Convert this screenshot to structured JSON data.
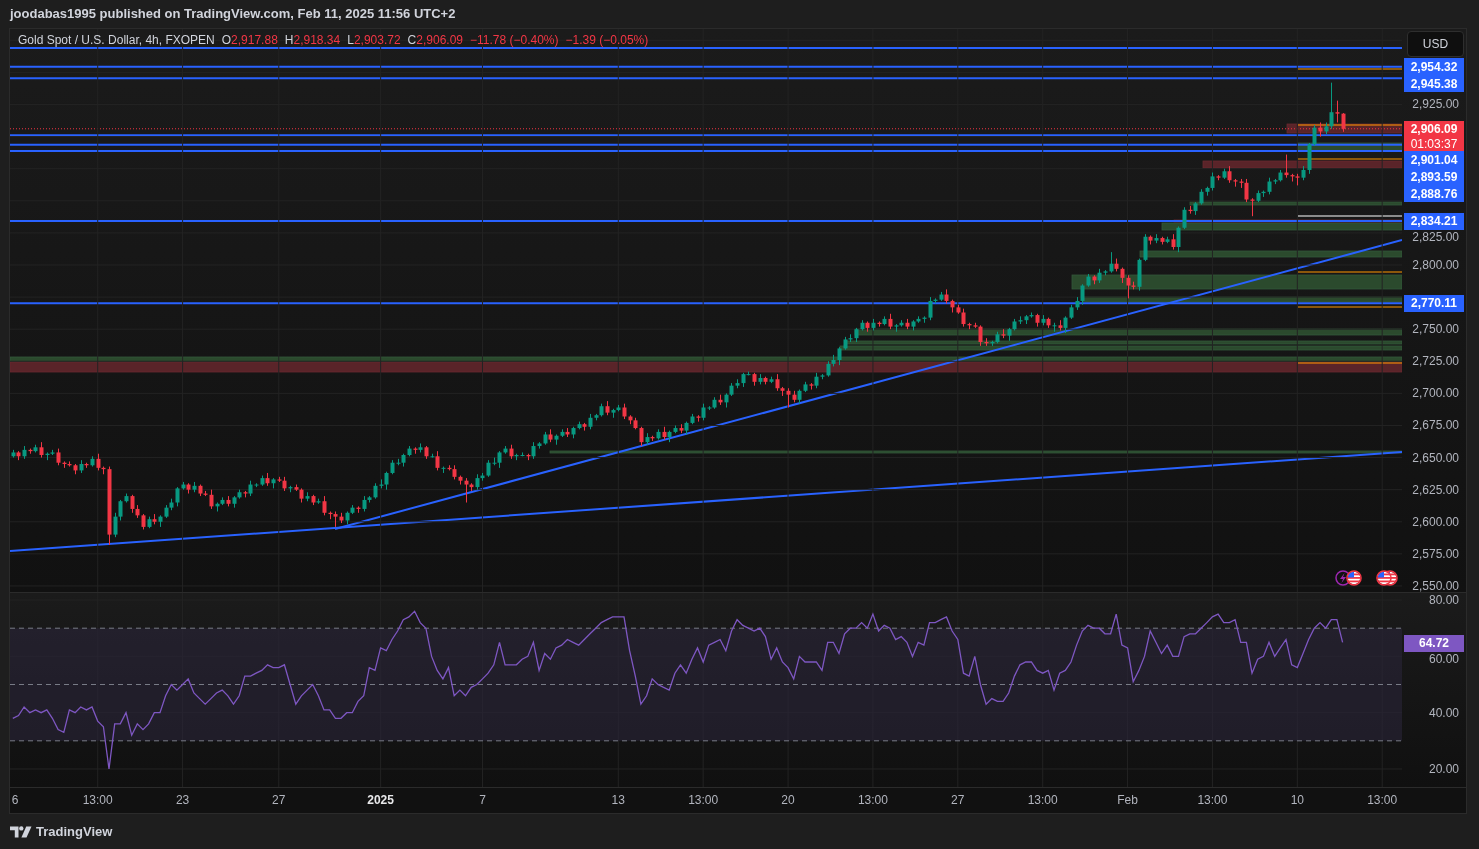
{
  "header": {
    "publish_note": "joodabas1995 published on TradingView.com, Feb 11, 2025 11:56 UTC+2"
  },
  "price_chart": {
    "legend": {
      "symbol": "Gold Spot / U.S. Dollar, 4h, FXOPEN",
      "ohlc": [
        {
          "key": "O",
          "value": "2,917.88"
        },
        {
          "key": "H",
          "value": "2,918.34"
        },
        {
          "key": "L",
          "value": "2,903.72"
        },
        {
          "key": "C",
          "value": "2,906.09"
        }
      ],
      "changes": [
        "−11.78 (−0.40%)",
        "−1.39 (−0.05%)"
      ]
    },
    "currency_button": "USD",
    "price_lines": [
      "2,954.32",
      "2,945.38",
      "2,901.04",
      "2,893.59",
      "2,888.76",
      "2,834.21",
      "2,770.11"
    ],
    "last_price": {
      "label": "2,906.09",
      "countdown": "01:03:37"
    },
    "chart_data": {
      "type": "candlestick",
      "grid": true,
      "ylim": [
        2545.3,
        2983.8
      ],
      "yticks": [
        {
          "value": 2925,
          "label": "2,925.00"
        },
        {
          "value": 2825,
          "label": "2,825.00"
        },
        {
          "value": 2800,
          "label": "2,800.00"
        },
        {
          "value": 2750,
          "label": "2,750.00"
        },
        {
          "value": 2725,
          "label": "2,725.00"
        },
        {
          "value": 2700,
          "label": "2,700.00"
        },
        {
          "value": 2675,
          "label": "2,675.00"
        },
        {
          "value": 2650,
          "label": "2,650.00"
        },
        {
          "value": 2625,
          "label": "2,625.00"
        },
        {
          "value": 2600,
          "label": "2,600.00"
        },
        {
          "value": 2575,
          "label": "2,575.00"
        },
        {
          "value": 2550,
          "label": "2,550.00"
        }
      ],
      "categories": [
        null,
        null,
        null,
        null,
        null,
        null,
        null,
        null,
        null,
        null,
        null,
        null,
        null,
        null,
        null,
        null,
        null,
        null,
        null,
        null,
        null,
        null,
        null,
        null,
        null,
        null,
        null,
        null,
        null,
        null,
        null,
        null,
        null,
        null,
        null,
        null,
        null,
        null,
        null,
        null,
        null,
        null,
        null,
        null,
        null,
        null,
        null,
        null,
        null,
        null,
        null,
        null,
        null,
        null,
        null,
        null,
        null,
        null,
        null,
        null,
        null,
        null,
        null,
        null,
        null,
        null,
        null,
        null,
        null,
        null,
        null,
        null,
        null,
        null,
        null,
        null,
        null,
        null,
        null,
        null,
        null,
        null,
        null,
        null,
        null,
        null,
        null,
        null,
        null,
        null,
        null,
        null,
        null,
        null,
        null,
        null,
        null,
        null,
        null,
        null,
        null,
        null,
        null,
        null,
        null,
        null,
        null,
        null,
        null,
        null,
        null,
        null,
        null,
        null,
        null,
        null,
        null,
        null,
        null,
        null,
        null,
        null,
        null,
        null,
        null,
        null,
        null,
        null,
        null,
        null,
        null,
        null,
        null,
        null,
        null,
        null,
        null,
        null,
        null,
        null,
        null,
        null,
        null,
        null,
        null,
        null,
        null,
        null,
        null,
        null,
        null,
        null,
        null,
        null,
        null,
        null,
        null,
        null,
        null,
        null,
        null,
        null,
        null,
        null,
        null,
        null,
        null,
        null,
        null,
        null,
        null,
        null,
        null,
        null,
        null,
        null,
        null,
        null,
        null,
        null,
        null,
        null,
        null,
        null,
        null,
        null,
        null,
        null,
        null,
        null,
        null,
        null,
        null,
        null,
        null,
        null,
        null,
        null,
        null,
        null,
        null,
        null,
        null,
        null,
        null,
        null,
        null,
        null,
        null,
        null,
        null,
        null,
        null,
        null,
        null,
        null,
        null,
        null,
        null,
        null,
        null,
        null,
        null,
        null,
        null,
        null,
        null,
        null,
        null,
        null,
        null,
        null,
        null,
        null,
        null,
        null,
        null,
        null,
        null,
        null,
        null,
        null,
        null,
        null,
        null,
        null
      ],
      "ohlc": [
        [
          2651,
          2656,
          2650,
          2654
        ],
        [
          2654,
          2655,
          2648,
          2651
        ],
        [
          2651,
          2659,
          2649,
          2656
        ],
        [
          2656,
          2657,
          2653,
          2655
        ],
        [
          2655,
          2660,
          2654,
          2658
        ],
        [
          2658,
          2662,
          2650,
          2652
        ],
        [
          2652,
          2654,
          2648,
          2653
        ],
        [
          2653,
          2656,
          2652,
          2654
        ],
        [
          2654,
          2657,
          2644,
          2646
        ],
        [
          2646,
          2647,
          2642,
          2645
        ],
        [
          2645,
          2647,
          2643,
          2644
        ],
        [
          2644,
          2645,
          2637,
          2640
        ],
        [
          2640,
          2648,
          2638,
          2645
        ],
        [
          2645,
          2646,
          2642,
          2644
        ],
        [
          2644,
          2651,
          2643,
          2649
        ],
        [
          2649,
          2653,
          2640,
          2642
        ],
        [
          2642,
          2643,
          2637,
          2641
        ],
        [
          2641,
          2643,
          2582,
          2590
        ],
        [
          2590,
          2607,
          2588,
          2604
        ],
        [
          2604,
          2617,
          2601,
          2616
        ],
        [
          2616,
          2622,
          2615,
          2620
        ],
        [
          2620,
          2621,
          2607,
          2610
        ],
        [
          2610,
          2613,
          2603,
          2605
        ],
        [
          2605,
          2606,
          2594,
          2596
        ],
        [
          2596,
          2604,
          2595,
          2602
        ],
        [
          2602,
          2606,
          2598,
          2600
        ],
        [
          2600,
          2605,
          2596,
          2604
        ],
        [
          2604,
          2613,
          2603,
          2611
        ],
        [
          2611,
          2618,
          2609,
          2615
        ],
        [
          2615,
          2627,
          2612,
          2626
        ],
        [
          2626,
          2631,
          2625,
          2629
        ],
        [
          2629,
          2630,
          2622,
          2625
        ],
        [
          2625,
          2631,
          2623,
          2628
        ],
        [
          2628,
          2629,
          2620,
          2622
        ],
        [
          2622,
          2624,
          2620,
          2621
        ],
        [
          2621,
          2625,
          2610,
          2612
        ],
        [
          2612,
          2615,
          2608,
          2614
        ],
        [
          2614,
          2619,
          2613,
          2617
        ],
        [
          2617,
          2620,
          2612,
          2614
        ],
        [
          2614,
          2620,
          2611,
          2619
        ],
        [
          2619,
          2625,
          2618,
          2623
        ],
        [
          2623,
          2624,
          2619,
          2622
        ],
        [
          2622,
          2632,
          2620,
          2629
        ],
        [
          2629,
          2630,
          2627,
          2629
        ],
        [
          2629,
          2636,
          2628,
          2634
        ],
        [
          2634,
          2638,
          2628,
          2630
        ],
        [
          2630,
          2634,
          2626,
          2633
        ],
        [
          2633,
          2635,
          2631,
          2632
        ],
        [
          2632,
          2635,
          2624,
          2626
        ],
        [
          2626,
          2628,
          2623,
          2627
        ],
        [
          2627,
          2629,
          2624,
          2625
        ],
        [
          2625,
          2626,
          2615,
          2618
        ],
        [
          2618,
          2623,
          2616,
          2620
        ],
        [
          2620,
          2621,
          2613,
          2615
        ],
        [
          2615,
          2618,
          2614,
          2616
        ],
        [
          2616,
          2620,
          2605,
          2607
        ],
        [
          2607,
          2608,
          2602,
          2606
        ],
        [
          2606,
          2608,
          2596,
          2604
        ],
        [
          2604,
          2607,
          2599,
          2601
        ],
        [
          2601,
          2608,
          2598,
          2607
        ],
        [
          2607,
          2613,
          2606,
          2611
        ],
        [
          2611,
          2612,
          2607,
          2610
        ],
        [
          2610,
          2620,
          2608,
          2617
        ],
        [
          2617,
          2620,
          2615,
          2619
        ],
        [
          2619,
          2630,
          2618,
          2628
        ],
        [
          2628,
          2633,
          2626,
          2629
        ],
        [
          2629,
          2639,
          2625,
          2638
        ],
        [
          2638,
          2648,
          2637,
          2646
        ],
        [
          2646,
          2649,
          2644,
          2646
        ],
        [
          2646,
          2653,
          2643,
          2652
        ],
        [
          2652,
          2659,
          2651,
          2657
        ],
        [
          2657,
          2658,
          2653,
          2656
        ],
        [
          2656,
          2661,
          2654,
          2658
        ],
        [
          2658,
          2659,
          2649,
          2651
        ],
        [
          2651,
          2653,
          2650,
          2651
        ],
        [
          2651,
          2655,
          2640,
          2642
        ],
        [
          2642,
          2643,
          2638,
          2642
        ],
        [
          2642,
          2644,
          2640,
          2641
        ],
        [
          2641,
          2644,
          2633,
          2635
        ],
        [
          2635,
          2636,
          2629,
          2632
        ],
        [
          2632,
          2634,
          2615,
          2629
        ],
        [
          2629,
          2630,
          2624,
          2627
        ],
        [
          2627,
          2637,
          2625,
          2634
        ],
        [
          2634,
          2638,
          2632,
          2636
        ],
        [
          2636,
          2648,
          2635,
          2646
        ],
        [
          2646,
          2650,
          2644,
          2646
        ],
        [
          2646,
          2655,
          2642,
          2654
        ],
        [
          2654,
          2659,
          2653,
          2657
        ],
        [
          2657,
          2660,
          2649,
          2651
        ],
        [
          2651,
          2653,
          2648,
          2652
        ],
        [
          2652,
          2654,
          2651,
          2652
        ],
        [
          2652,
          2653,
          2648,
          2651
        ],
        [
          2651,
          2662,
          2649,
          2659
        ],
        [
          2659,
          2662,
          2657,
          2661
        ],
        [
          2661,
          2670,
          2660,
          2668
        ],
        [
          2668,
          2672,
          2662,
          2664
        ],
        [
          2664,
          2668,
          2660,
          2667
        ],
        [
          2667,
          2672,
          2666,
          2670
        ],
        [
          2670,
          2673,
          2666,
          2668
        ],
        [
          2668,
          2674,
          2665,
          2673
        ],
        [
          2673,
          2678,
          2672,
          2676
        ],
        [
          2676,
          2677,
          2671,
          2674
        ],
        [
          2674,
          2684,
          2672,
          2681
        ],
        [
          2681,
          2684,
          2679,
          2683
        ],
        [
          2683,
          2692,
          2682,
          2690
        ],
        [
          2690,
          2694,
          2683,
          2685
        ],
        [
          2685,
          2688,
          2681,
          2687
        ],
        [
          2687,
          2691,
          2686,
          2689
        ],
        [
          2689,
          2692,
          2680,
          2682
        ],
        [
          2682,
          2683,
          2676,
          2679
        ],
        [
          2679,
          2681,
          2672,
          2673
        ],
        [
          2673,
          2674,
          2659,
          2662
        ],
        [
          2662,
          2669,
          2660,
          2666
        ],
        [
          2666,
          2667,
          2663,
          2665
        ],
        [
          2665,
          2672,
          2664,
          2670
        ],
        [
          2670,
          2674,
          2664,
          2666
        ],
        [
          2666,
          2671,
          2662,
          2670
        ],
        [
          2670,
          2675,
          2669,
          2673
        ],
        [
          2673,
          2676,
          2669,
          2671
        ],
        [
          2671,
          2678,
          2668,
          2677
        ],
        [
          2677,
          2684,
          2676,
          2682
        ],
        [
          2682,
          2683,
          2678,
          2681
        ],
        [
          2681,
          2692,
          2679,
          2689
        ],
        [
          2689,
          2690,
          2687,
          2689
        ],
        [
          2689,
          2697,
          2688,
          2695
        ],
        [
          2695,
          2699,
          2691,
          2693
        ],
        [
          2693,
          2700,
          2689,
          2699
        ],
        [
          2699,
          2708,
          2698,
          2706
        ],
        [
          2706,
          2711,
          2704,
          2708
        ],
        [
          2708,
          2716,
          2705,
          2715
        ],
        [
          2715,
          2717,
          2714,
          2715
        ],
        [
          2715,
          2716,
          2706,
          2709
        ],
        [
          2709,
          2715,
          2707,
          2712
        ],
        [
          2712,
          2713,
          2707,
          2709
        ],
        [
          2709,
          2713,
          2708,
          2711
        ],
        [
          2711,
          2715,
          2702,
          2704
        ],
        [
          2704,
          2705,
          2698,
          2702
        ],
        [
          2702,
          2704,
          2689,
          2699
        ],
        [
          2699,
          2702,
          2693,
          2695
        ],
        [
          2695,
          2703,
          2692,
          2702
        ],
        [
          2702,
          2709,
          2701,
          2707
        ],
        [
          2707,
          2708,
          2703,
          2706
        ],
        [
          2706,
          2716,
          2704,
          2713
        ],
        [
          2713,
          2715,
          2711,
          2714
        ],
        [
          2714,
          2725,
          2713,
          2723
        ],
        [
          2723,
          2730,
          2721,
          2726
        ],
        [
          2726,
          2736,
          2722,
          2735
        ],
        [
          2735,
          2744,
          2734,
          2742
        ],
        [
          2742,
          2746,
          2740,
          2743
        ],
        [
          2743,
          2751,
          2740,
          2750
        ],
        [
          2750,
          2757,
          2749,
          2755
        ],
        [
          2755,
          2756,
          2748,
          2751
        ],
        [
          2751,
          2758,
          2749,
          2755
        ],
        [
          2755,
          2756,
          2752,
          2754
        ],
        [
          2754,
          2760,
          2753,
          2758
        ],
        [
          2758,
          2762,
          2750,
          2752
        ],
        [
          2752,
          2754,
          2748,
          2753
        ],
        [
          2753,
          2757,
          2752,
          2755
        ],
        [
          2755,
          2758,
          2750,
          2752
        ],
        [
          2752,
          2757,
          2749,
          2756
        ],
        [
          2756,
          2760,
          2755,
          2758
        ],
        [
          2758,
          2760,
          2755,
          2759
        ],
        [
          2759,
          2775,
          2757,
          2772
        ],
        [
          2772,
          2774,
          2770,
          2773
        ],
        [
          2773,
          2779,
          2772,
          2777
        ],
        [
          2777,
          2781,
          2770,
          2772
        ],
        [
          2772,
          2773,
          2763,
          2767
        ],
        [
          2767,
          2769,
          2762,
          2763
        ],
        [
          2763,
          2766,
          2752,
          2754
        ],
        [
          2754,
          2755,
          2750,
          2753
        ],
        [
          2753,
          2755,
          2751,
          2752
        ],
        [
          2752,
          2753,
          2737,
          2740
        ],
        [
          2740,
          2743,
          2737,
          2739
        ],
        [
          2739,
          2741,
          2737,
          2740
        ],
        [
          2740,
          2748,
          2739,
          2746
        ],
        [
          2746,
          2750,
          2743,
          2745
        ],
        [
          2745,
          2751,
          2741,
          2750
        ],
        [
          2750,
          2758,
          2749,
          2756
        ],
        [
          2756,
          2760,
          2754,
          2757
        ],
        [
          2757,
          2761,
          2754,
          2760
        ],
        [
          2760,
          2763,
          2759,
          2761
        ],
        [
          2761,
          2762,
          2752,
          2755
        ],
        [
          2755,
          2761,
          2753,
          2758
        ],
        [
          2758,
          2759,
          2751,
          2753
        ],
        [
          2753,
          2755,
          2748,
          2753
        ],
        [
          2753,
          2757,
          2749,
          2751
        ],
        [
          2751,
          2760,
          2747,
          2759
        ],
        [
          2759,
          2769,
          2758,
          2767
        ],
        [
          2767,
          2775,
          2765,
          2772
        ],
        [
          2772,
          2785,
          2769,
          2784
        ],
        [
          2784,
          2793,
          2783,
          2791
        ],
        [
          2791,
          2792,
          2785,
          2788
        ],
        [
          2788,
          2797,
          2786,
          2794
        ],
        [
          2794,
          2796,
          2792,
          2795
        ],
        [
          2795,
          2810,
          2794,
          2801
        ],
        [
          2801,
          2805,
          2795,
          2797
        ],
        [
          2797,
          2798,
          2786,
          2790
        ],
        [
          2790,
          2792,
          2774,
          2784
        ],
        [
          2784,
          2787,
          2781,
          2783
        ],
        [
          2783,
          2805,
          2780,
          2804
        ],
        [
          2804,
          2824,
          2803,
          2822
        ],
        [
          2822,
          2823,
          2816,
          2819
        ],
        [
          2819,
          2824,
          2817,
          2821
        ],
        [
          2821,
          2822,
          2816,
          2818
        ],
        [
          2818,
          2822,
          2817,
          2820
        ],
        [
          2820,
          2824,
          2812,
          2814
        ],
        [
          2814,
          2830,
          2810,
          2829
        ],
        [
          2829,
          2845,
          2828,
          2843
        ],
        [
          2843,
          2846,
          2840,
          2842
        ],
        [
          2842,
          2849,
          2839,
          2848
        ],
        [
          2848,
          2859,
          2847,
          2857
        ],
        [
          2857,
          2861,
          2854,
          2860
        ],
        [
          2860,
          2872,
          2858,
          2869
        ],
        [
          2869,
          2870,
          2866,
          2868
        ],
        [
          2868,
          2875,
          2867,
          2873
        ],
        [
          2873,
          2877,
          2864,
          2866
        ],
        [
          2866,
          2867,
          2861,
          2865
        ],
        [
          2865,
          2867,
          2860,
          2864
        ],
        [
          2864,
          2867,
          2849,
          2851
        ],
        [
          2851,
          2852,
          2838,
          2850
        ],
        [
          2850,
          2858,
          2849,
          2856
        ],
        [
          2856,
          2858,
          2853,
          2857
        ],
        [
          2857,
          2868,
          2855,
          2865
        ],
        [
          2865,
          2867,
          2863,
          2866
        ],
        [
          2866,
          2874,
          2865,
          2872
        ],
        [
          2872,
          2886,
          2868,
          2870
        ],
        [
          2870,
          2871,
          2865,
          2869
        ],
        [
          2869,
          2871,
          2862,
          2868
        ],
        [
          2868,
          2877,
          2866,
          2874
        ],
        [
          2874,
          2895,
          2871,
          2894
        ],
        [
          2894,
          2909,
          2893,
          2907
        ],
        [
          2907,
          2911,
          2900,
          2904
        ],
        [
          2904,
          2911,
          2902,
          2908
        ],
        [
          2908,
          2942,
          2906,
          2919
        ],
        [
          2919,
          2928,
          2911,
          2917.88
        ],
        [
          2917.88,
          2918.34,
          2903.72,
          2906.09
        ],
        null,
        null,
        null,
        null,
        null,
        null,
        null,
        null,
        null,
        null
      ]
    }
  },
  "rsi": {
    "value_label": "64.72",
    "time_labels_major": [
      false,
      false,
      false,
      false,
      true,
      false,
      false,
      false,
      false,
      false,
      false,
      false,
      false,
      false,
      false,
      false
    ],
    "chart_data": {
      "type": "line",
      "grid": true,
      "ylim": [
        13.6,
        82.5
      ],
      "yticks": [
        {
          "value": 80,
          "label": "80.00"
        },
        {
          "value": 60,
          "label": "60.00"
        },
        {
          "value": 40,
          "label": "40.00"
        },
        {
          "value": 20,
          "label": "20.00"
        }
      ],
      "categories": [
        "6",
        null,
        null,
        null,
        null,
        null,
        null,
        null,
        null,
        null,
        null,
        null,
        null,
        null,
        null,
        "13:00",
        null,
        null,
        null,
        null,
        null,
        null,
        null,
        null,
        null,
        null,
        null,
        null,
        null,
        null,
        "23",
        null,
        null,
        null,
        null,
        null,
        null,
        null,
        null,
        null,
        null,
        null,
        null,
        null,
        null,
        null,
        null,
        "27",
        null,
        null,
        null,
        null,
        null,
        null,
        null,
        null,
        null,
        null,
        null,
        null,
        null,
        null,
        null,
        null,
        null,
        "2025",
        null,
        null,
        null,
        null,
        null,
        null,
        null,
        null,
        null,
        null,
        null,
        null,
        null,
        null,
        null,
        null,
        null,
        "7",
        null,
        null,
        null,
        null,
        null,
        null,
        null,
        null,
        null,
        null,
        null,
        null,
        null,
        null,
        null,
        null,
        null,
        null,
        null,
        null,
        null,
        null,
        null,
        "13",
        null,
        null,
        null,
        null,
        null,
        null,
        null,
        null,
        null,
        null,
        null,
        null,
        null,
        null,
        "13:00",
        null,
        null,
        null,
        null,
        null,
        null,
        null,
        null,
        null,
        null,
        null,
        null,
        null,
        null,
        "20",
        null,
        null,
        null,
        null,
        null,
        null,
        null,
        null,
        null,
        null,
        null,
        null,
        null,
        null,
        "13:00",
        null,
        null,
        null,
        null,
        null,
        null,
        null,
        null,
        null,
        null,
        null,
        null,
        null,
        null,
        "27",
        null,
        null,
        null,
        null,
        null,
        null,
        null,
        null,
        null,
        null,
        null,
        null,
        null,
        null,
        "13:00",
        null,
        null,
        null,
        null,
        null,
        null,
        null,
        null,
        null,
        null,
        null,
        null,
        null,
        null,
        "Feb",
        null,
        null,
        null,
        null,
        null,
        null,
        null,
        null,
        null,
        null,
        null,
        null,
        null,
        null,
        "13:00",
        null,
        null,
        null,
        null,
        null,
        null,
        null,
        null,
        null,
        null,
        null,
        null,
        null,
        null,
        "10",
        null,
        null,
        null,
        null,
        null,
        null,
        null,
        null,
        null,
        null,
        null,
        null,
        null,
        null,
        "13:00",
        null,
        null,
        null
      ],
      "series": [
        {
          "color": "#7e57c2",
          "values": [
            38,
            39,
            42,
            40,
            41,
            40,
            41,
            38,
            34,
            33,
            41,
            40,
            42,
            41,
            42,
            37,
            35,
            20,
            36,
            36,
            40,
            32,
            36,
            34,
            36,
            40,
            40,
            46,
            50,
            48,
            50,
            52,
            47,
            45,
            43,
            45,
            47,
            48,
            46,
            43,
            46,
            53,
            53,
            54,
            55,
            57,
            56,
            56,
            57,
            50,
            43,
            46,
            48,
            50,
            46,
            41,
            41,
            38,
            38,
            40,
            40,
            44,
            46,
            56,
            55,
            63,
            62,
            66,
            69,
            73,
            74,
            76,
            72,
            70,
            60,
            55,
            52,
            56,
            46,
            48,
            46,
            49,
            50,
            52,
            54,
            57,
            65,
            57,
            57,
            57,
            59,
            60,
            65,
            55,
            61,
            59,
            63,
            64,
            66,
            65,
            64,
            66,
            68,
            70,
            72,
            73,
            74,
            74,
            74,
            62,
            53,
            43,
            46,
            52,
            50,
            49,
            48,
            54,
            57,
            54,
            59,
            63,
            58,
            64,
            65,
            66,
            62,
            69,
            73,
            71,
            70,
            69,
            70,
            67,
            59,
            63,
            58,
            56,
            52,
            60,
            58,
            58,
            58,
            55,
            65,
            65,
            61,
            68,
            70,
            70,
            72,
            70,
            75,
            69,
            71,
            70,
            66,
            67,
            65,
            60,
            65,
            64,
            72,
            72,
            73,
            74,
            69,
            66,
            54,
            53,
            60,
            50,
            43,
            45,
            44,
            44,
            47,
            53,
            57,
            58,
            58,
            55,
            54,
            55,
            48,
            54,
            55,
            58,
            64,
            69,
            71,
            70,
            70,
            68,
            68,
            75,
            64,
            63,
            51,
            55,
            60,
            69,
            65,
            61,
            64,
            60,
            60,
            67,
            68,
            68,
            70,
            72,
            74,
            75,
            72,
            72,
            73,
            65,
            65,
            54,
            59,
            60,
            65,
            60,
            63,
            66,
            57,
            56,
            61,
            66,
            70,
            72,
            70,
            73,
            73,
            65,
            null,
            null,
            null,
            null,
            null,
            null,
            null,
            null,
            null,
            null
          ]
        }
      ]
    }
  },
  "footer": {
    "brand": "TradingView"
  }
}
